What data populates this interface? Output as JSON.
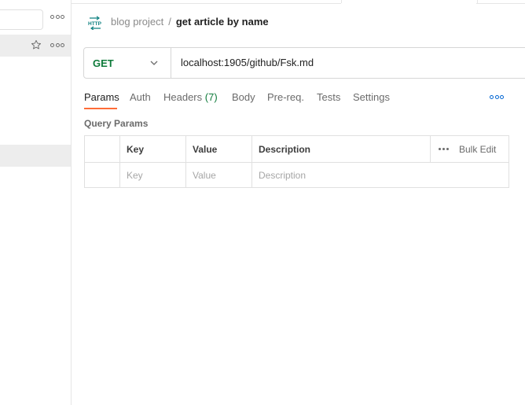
{
  "breadcrumb": {
    "parent": "blog project",
    "separator": "/",
    "current": "get article by name"
  },
  "request": {
    "method": "GET",
    "url": "localhost:1905/github/Fsk.md"
  },
  "tabs": [
    {
      "label": "Params",
      "count": ""
    },
    {
      "label": "Auth",
      "count": ""
    },
    {
      "label": "Headers",
      "count": "(7)"
    },
    {
      "label": "Body",
      "count": ""
    },
    {
      "label": "Pre-req.",
      "count": ""
    },
    {
      "label": "Tests",
      "count": ""
    },
    {
      "label": "Settings",
      "count": ""
    }
  ],
  "active_tab": "Params",
  "query_params": {
    "title": "Query Params",
    "columns": [
      "Key",
      "Value",
      "Description"
    ],
    "bulk_edit": "Bulk Edit",
    "placeholders": [
      "Key",
      "Value",
      "Description"
    ]
  },
  "icons": {
    "http": "http-request-icon",
    "star": "star-icon",
    "more": "more-dots-icon",
    "chevron": "chevron-down-icon"
  },
  "colors": {
    "accent_orange": "#ff6c37",
    "method_green": "#0f7b3b",
    "link_blue": "#0265d2"
  }
}
